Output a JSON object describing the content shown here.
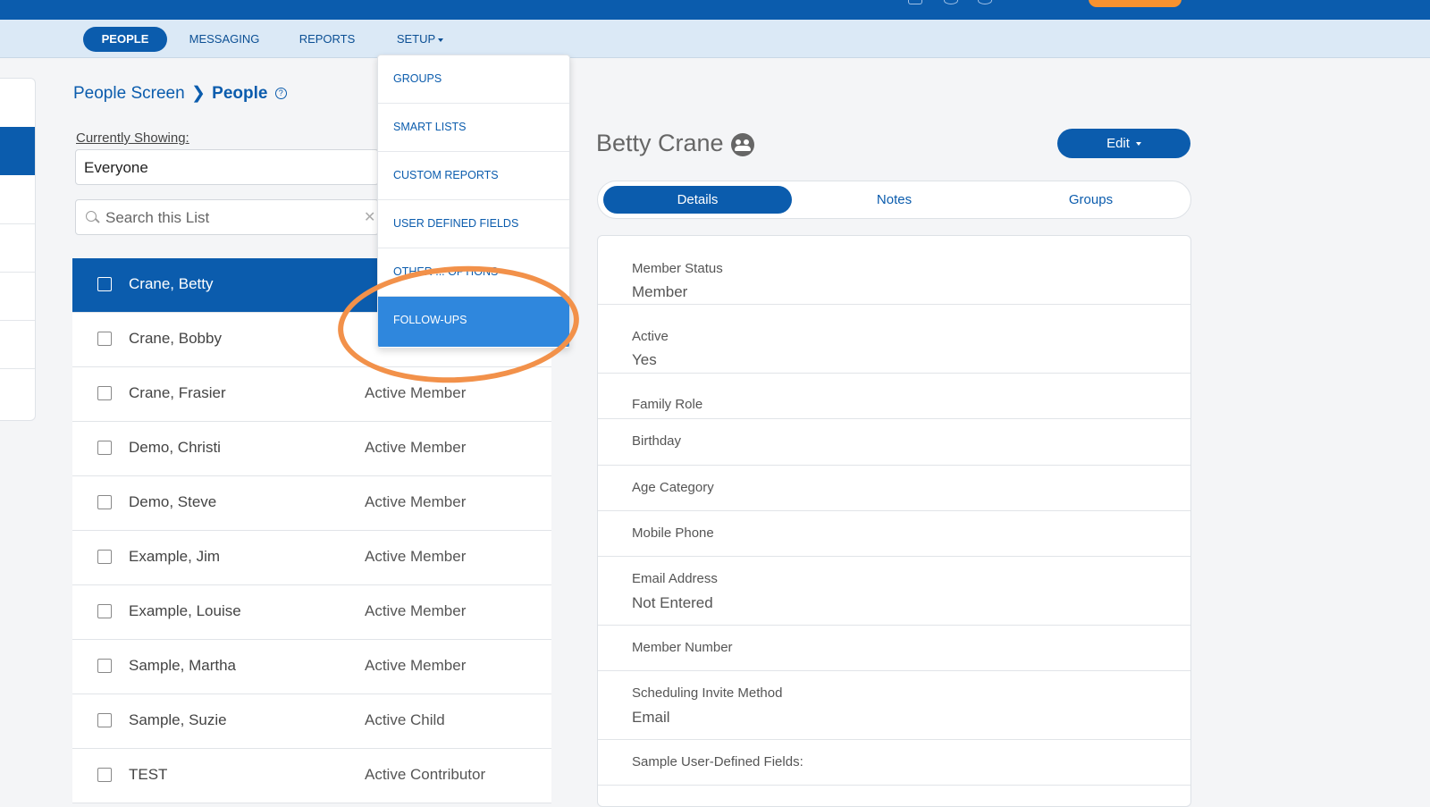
{
  "nav": {
    "items": [
      {
        "label": "PEOPLE",
        "active": true
      },
      {
        "label": "MESSAGING",
        "active": false
      },
      {
        "label": "REPORTS",
        "active": false
      },
      {
        "label": "SETUP",
        "active": false
      }
    ]
  },
  "breadcrumb": {
    "parent": "People Screen",
    "current": "People"
  },
  "showing": {
    "label": "Currently Showing:",
    "value": "Everyone"
  },
  "search": {
    "placeholder": "Search this List",
    "value": ""
  },
  "people": [
    {
      "name": "Crane, Betty",
      "status": "",
      "selected": true
    },
    {
      "name": "Crane, Bobby",
      "status": "",
      "selected": false
    },
    {
      "name": "Crane, Frasier",
      "status": "Active Member",
      "selected": false
    },
    {
      "name": "Demo, Christi",
      "status": "Active Member",
      "selected": false
    },
    {
      "name": "Demo, Steve",
      "status": "Active Member",
      "selected": false
    },
    {
      "name": "Example, Jim",
      "status": "Active Member",
      "selected": false
    },
    {
      "name": "Example, Louise",
      "status": "Active Member",
      "selected": false
    },
    {
      "name": "Sample, Martha",
      "status": "Active Member",
      "selected": false
    },
    {
      "name": "Sample, Suzie",
      "status": "Active Child",
      "selected": false
    },
    {
      "name": "TEST",
      "status": "Active Contributor",
      "selected": false
    }
  ],
  "setup_menu": {
    "items": [
      {
        "label": "GROUPS",
        "highlighted": false
      },
      {
        "label": "SMART LISTS",
        "highlighted": false
      },
      {
        "label": "CUSTOM REPORTS",
        "highlighted": false
      },
      {
        "label": "USER DEFINED FIELDS",
        "highlighted": false
      },
      {
        "label": "OTHER ... OPTIONS",
        "highlighted": false
      },
      {
        "label": "FOLLOW-UPS",
        "highlighted": true
      }
    ]
  },
  "person": {
    "name": "Betty Crane",
    "edit_label": "Edit",
    "tabs": [
      {
        "label": "Details",
        "active": true
      },
      {
        "label": "Notes",
        "active": false
      },
      {
        "label": "Groups",
        "active": false
      }
    ],
    "fields": [
      {
        "label": "Member Status",
        "value": "Member"
      },
      {
        "label": "Active",
        "value": "Yes"
      },
      {
        "label": "Family Role",
        "value": ""
      },
      {
        "label": "Birthday",
        "value": ""
      },
      {
        "label": "Age Category",
        "value": ""
      },
      {
        "label": "Mobile Phone",
        "value": ""
      },
      {
        "label": "Email Address",
        "value": "Not Entered"
      },
      {
        "label": "Member Number",
        "value": ""
      },
      {
        "label": "Scheduling Invite Method",
        "value": "Email"
      },
      {
        "label": "Sample User-Defined Fields:",
        "value": ""
      }
    ]
  },
  "colors": {
    "brand_blue": "#0b5cad",
    "menu_highlight": "#2f87dd",
    "annotation_orange": "#f2914a",
    "topbar_orange": "#f7922f"
  }
}
